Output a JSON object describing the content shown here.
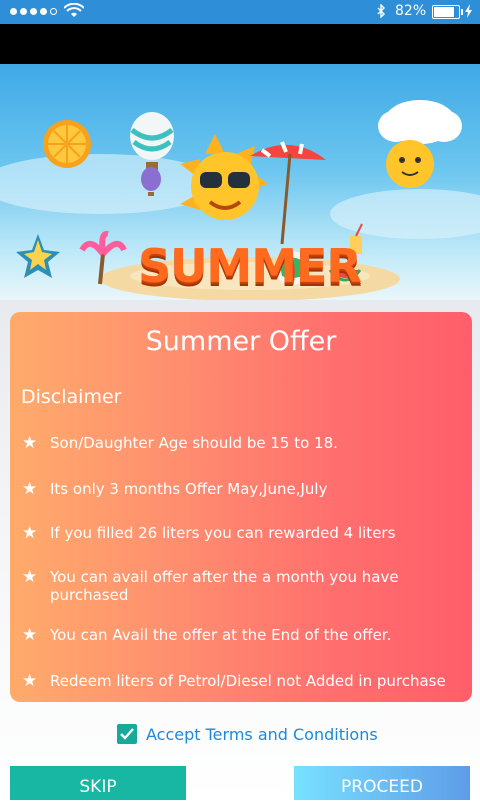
{
  "status_bar": {
    "battery": "82%"
  },
  "banner": {
    "title": "SUMMER"
  },
  "card": {
    "title": "Summer Offer",
    "disclaimer": "Disclaimer",
    "rules": [
      "Son/Daughter Age should be 15 to 18.",
      "Its only 3 months Offer May,June,July",
      "If you filled 26 liters you can rewarded 4 liters",
      "You can avail offer after the a month you have purchased",
      "You can Avail the offer at the End of the offer.",
      "Redeem liters of Petrol/Diesel not Added in purchase"
    ]
  },
  "accept": {
    "label": "Accept Terms and Conditions"
  },
  "buttons": {
    "skip": "SKIP",
    "proceed": "PROCEED"
  }
}
